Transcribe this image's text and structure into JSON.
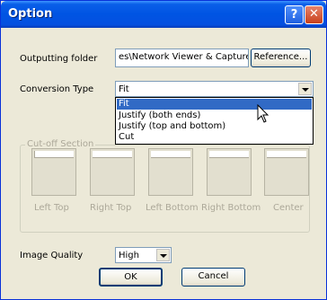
{
  "window": {
    "title": "Option",
    "help_glyph": "?",
    "close_glyph": "✕"
  },
  "output_folder": {
    "label": "Outputting folder",
    "value": "es\\Network Viewer & Capture",
    "button": "Reference..."
  },
  "conversion": {
    "label": "Conversion Type",
    "value": "Fit",
    "options": [
      "Fit",
      "Justify (both ends)",
      "Justify (top and bottom)",
      "Cut"
    ],
    "highlighted_index": 0
  },
  "cutoff": {
    "legend": "Cut-off Section",
    "positions": [
      "Left Top",
      "Right Top",
      "Left Bottom",
      "Right Bottom",
      "Center"
    ]
  },
  "quality": {
    "label": "Image Quality",
    "value": "High"
  },
  "buttons": {
    "ok": "OK",
    "cancel": "Cancel"
  },
  "colors": {
    "titlebar": "#0054e3",
    "highlight": "#316ac5",
    "disabled_text": "#aca899"
  }
}
